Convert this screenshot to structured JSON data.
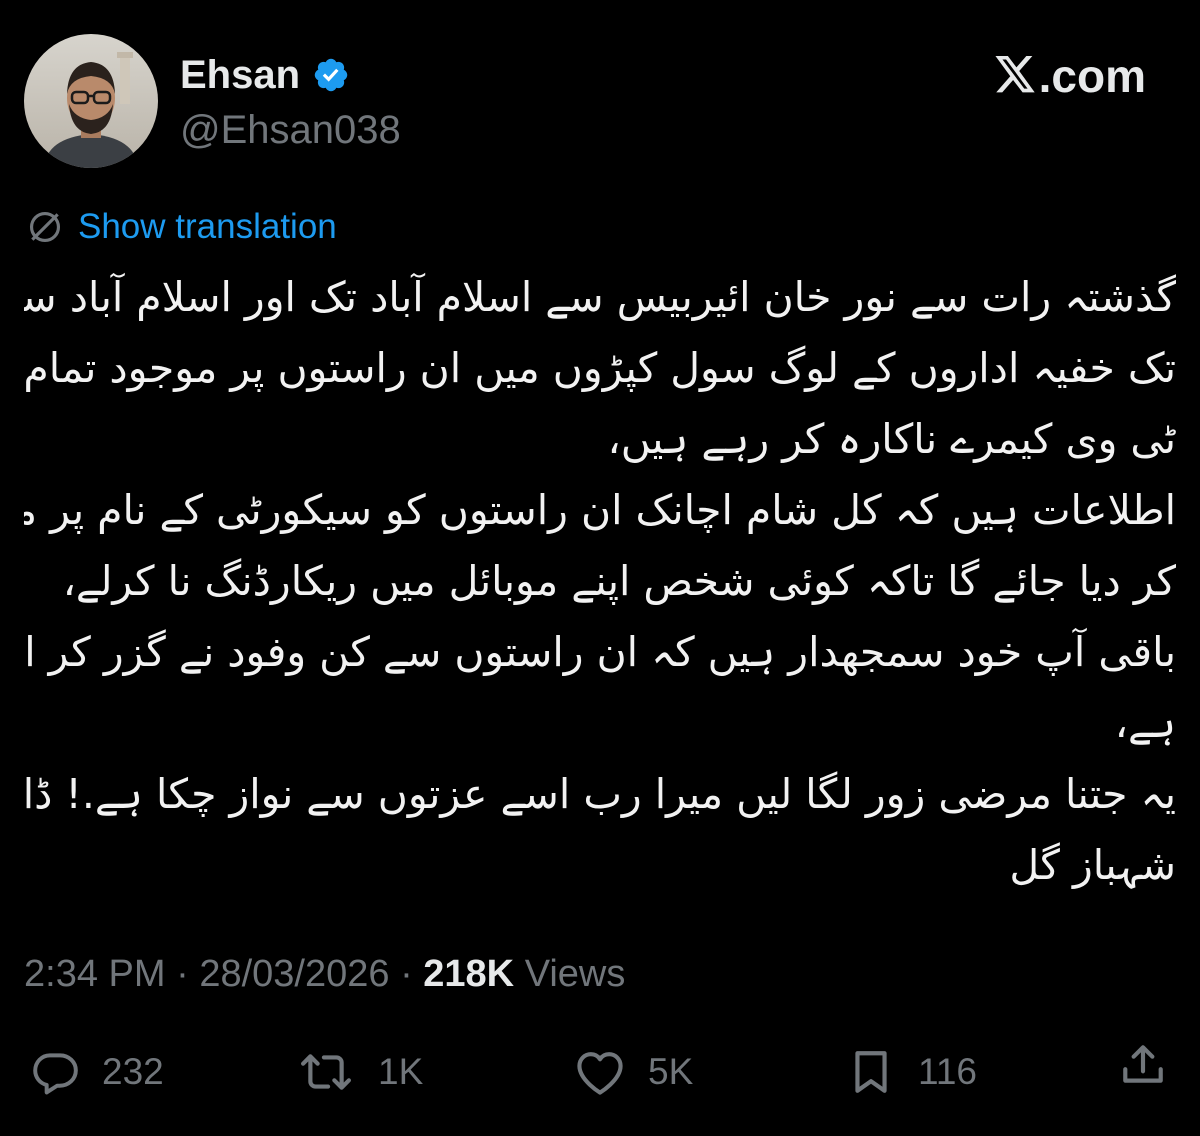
{
  "author": {
    "display_name": "Ehsan",
    "handle": "@Ehsan038",
    "avatar_icon": "profile-photo",
    "verified_icon": "verified-badge-icon",
    "verified_color": "#1d9bf0"
  },
  "brand": {
    "icon": "x-logo-icon",
    "suffix": ".com"
  },
  "translation": {
    "icon": "translate-globe-icon",
    "label": "Show translation",
    "color": "#1d9bf0"
  },
  "tweet": {
    "lines": [
      "گذشتہ رات سے نور خان ائیربیس سے اسلام آباد تک اور اسلام آباد سے اڈیالہ",
      "تک خفیہ اداروں کے لوگ سول کپڑوں میں ان راستوں پر موجود تمام سی سی",
      "ٹی وی کیمرے ناکارہ کر رہے ہیں،",
      "اطلاعات ہیں کہ کل شام اچانک ان راستوں کو سیکورٹی کے نام پر مکمل سیل",
      "کر دیا جائے گا تاکہ کوئی شخص اپنے موبائل میں ریکارڈنگ نا کرلے،",
      "باقی آپ خود سمجھدار ہیں کہ ان راستوں سے کن وفود نے گزر کر اڈیالہ جانا",
      "ہے،",
      "یہ جتنا مرضی زور لگا لیں میرا رب اسے عزتوں سے نواز چکا ہے.! ڈاکٹر",
      "شہباز گل"
    ]
  },
  "meta": {
    "time": "2:34 PM",
    "separator": "·",
    "date": "28/03/2026",
    "views_count": "218K",
    "views_label": "Views"
  },
  "actions": {
    "reply": {
      "icon": "reply-icon",
      "count": "232"
    },
    "repost": {
      "icon": "repost-icon",
      "count": "1K"
    },
    "like": {
      "icon": "heart-icon",
      "count": "5K"
    },
    "bookmark": {
      "icon": "bookmark-icon",
      "count": "116"
    },
    "share": {
      "icon": "share-icon"
    }
  },
  "colors": {
    "background": "#000000",
    "text_primary": "#e7e9ea",
    "text_secondary": "#71767b",
    "accent": "#1d9bf0"
  }
}
